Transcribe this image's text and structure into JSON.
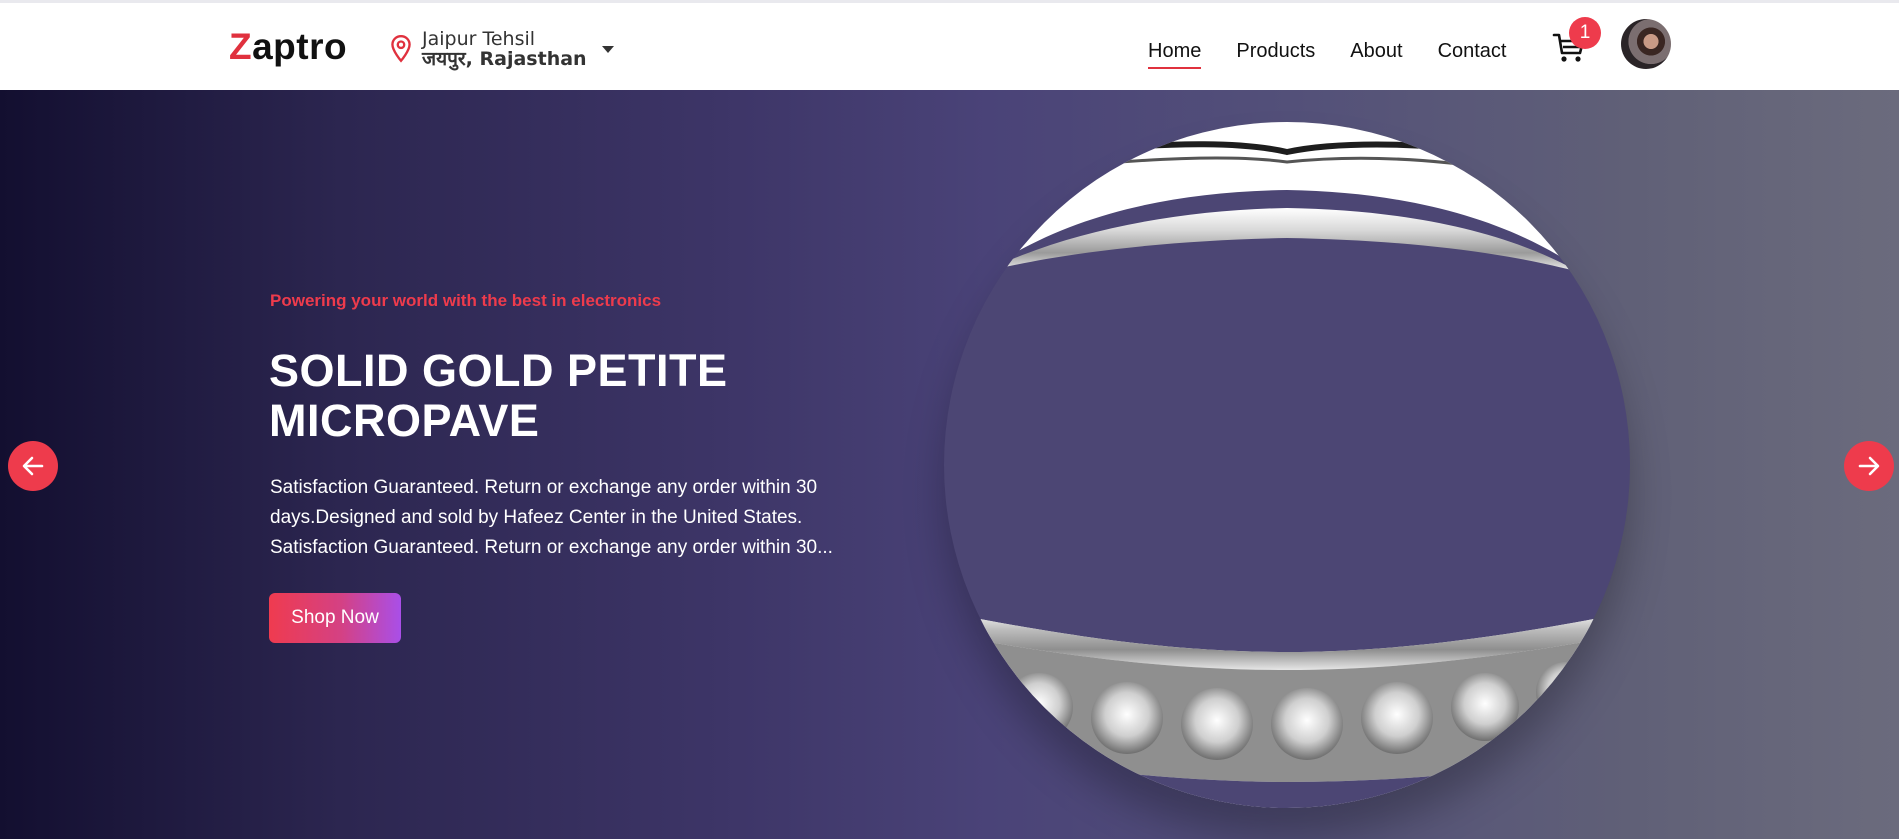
{
  "brand": {
    "logo_first": "Z",
    "logo_rest": "aptro",
    "accent_color": "#e0313e"
  },
  "location": {
    "line1": "Jaipur Tehsil",
    "line2": "जयपुर, Rajasthan",
    "icon": "map-pin-icon"
  },
  "nav": {
    "items": [
      {
        "label": "Home",
        "active": true
      },
      {
        "label": "Products",
        "active": false
      },
      {
        "label": "About",
        "active": false
      },
      {
        "label": "Contact",
        "active": false
      }
    ]
  },
  "cart": {
    "icon": "shopping-cart-icon",
    "count": "1"
  },
  "hero": {
    "tagline": "Powering your world with the best in electronics",
    "title": "SOLID GOLD PETITE MICROPAVE",
    "description": "Satisfaction Guaranteed. Return or exchange any order within 30 days.Designed and sold by Hafeez Center in the United States. Satisfaction Guaranteed. Return or exchange any order within 30...",
    "cta_label": "Shop Now",
    "prev_icon": "arrow-left-icon",
    "next_icon": "arrow-right-icon"
  }
}
